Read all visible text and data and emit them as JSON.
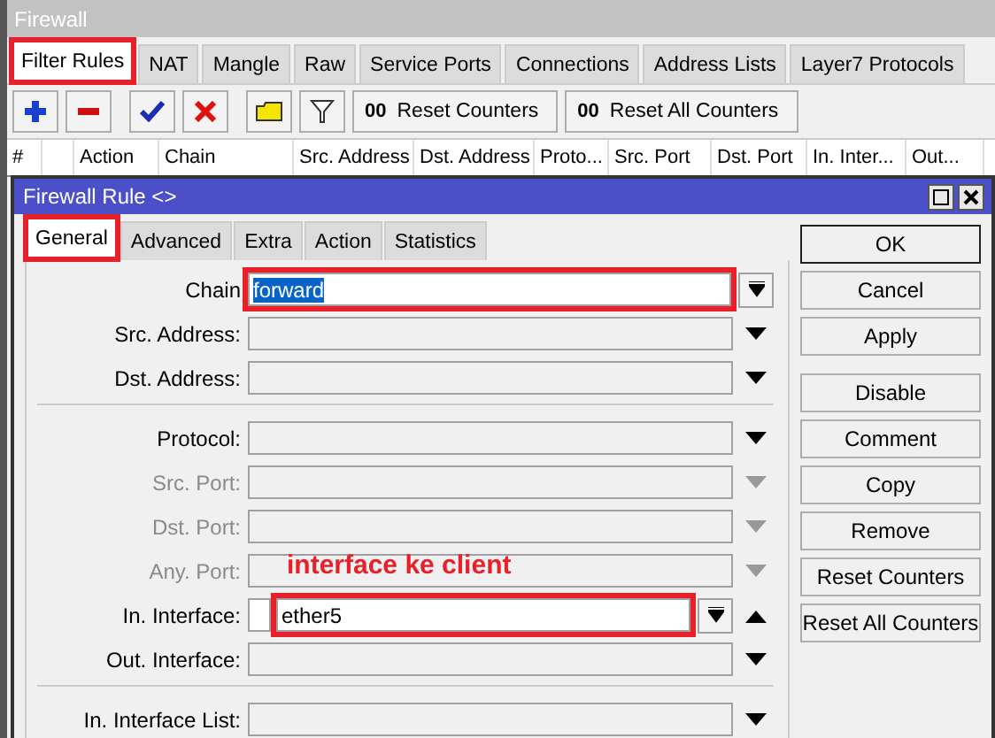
{
  "window": {
    "title": "Firewall"
  },
  "tabs": [
    {
      "label": "Filter Rules",
      "selected": true,
      "highlighted": true
    },
    {
      "label": "NAT",
      "selected": false,
      "highlighted": false
    },
    {
      "label": "Mangle",
      "selected": false,
      "highlighted": false
    },
    {
      "label": "Raw",
      "selected": false,
      "highlighted": false
    },
    {
      "label": "Service Ports",
      "selected": false,
      "highlighted": false
    },
    {
      "label": "Connections",
      "selected": false,
      "highlighted": false
    },
    {
      "label": "Address Lists",
      "selected": false,
      "highlighted": false
    },
    {
      "label": "Layer7 Protocols",
      "selected": false,
      "highlighted": false
    }
  ],
  "toolbar": {
    "icons": [
      {
        "kind": "add"
      },
      {
        "kind": "remove"
      },
      {
        "kind": "enable"
      },
      {
        "kind": "disable"
      },
      {
        "kind": "comment"
      },
      {
        "kind": "filter"
      }
    ],
    "buttons": [
      {
        "prefix": "00",
        "label": "Reset Counters"
      },
      {
        "prefix": "00",
        "label": "Reset All Counters"
      }
    ]
  },
  "table": {
    "columns": [
      {
        "label": "#"
      },
      {},
      {
        "label": "Action"
      },
      {
        "label": "Chain"
      },
      {
        "label": "Src. Address"
      },
      {
        "label": "Dst. Address"
      },
      {
        "label": "Proto..."
      },
      {
        "label": "Src. Port"
      },
      {
        "label": "Dst. Port"
      },
      {
        "label": "In. Inter..."
      },
      {
        "label": "Out..."
      }
    ]
  },
  "dialog": {
    "title": "Firewall Rule <>",
    "tabs": [
      {
        "label": "General",
        "selected": true,
        "highlighted": true
      },
      {
        "label": "Advanced",
        "selected": false,
        "highlighted": false
      },
      {
        "label": "Extra",
        "selected": false,
        "highlighted": false
      },
      {
        "label": "Action",
        "selected": false,
        "highlighted": false
      },
      {
        "label": "Statistics",
        "selected": false,
        "highlighted": false
      }
    ],
    "fields": [
      {
        "kind": "select",
        "label": "Chain",
        "value": "forward",
        "selected": true,
        "highlighted": true,
        "disabled": false
      },
      {
        "kind": "arrow",
        "label": "Src. Address:",
        "disabled": false
      },
      {
        "kind": "arrow",
        "label": "Dst. Address:",
        "disabled": false
      },
      {
        "kind": "separator"
      },
      {
        "kind": "arrow",
        "label": "Protocol:",
        "disabled": false
      },
      {
        "kind": "arrow",
        "label": "Src. Port:",
        "disabled": true
      },
      {
        "kind": "arrow",
        "label": "Dst. Port:",
        "disabled": true
      },
      {
        "kind": "arrow",
        "label": "Any. Port:",
        "disabled": true,
        "annotation": "interface ke client"
      },
      {
        "kind": "interface",
        "label": "In. Interface:",
        "value": "ether5",
        "selected": false,
        "highlighted": true,
        "disabled": false,
        "negated": false
      },
      {
        "kind": "arrow",
        "label": "Out. Interface:",
        "disabled": false
      },
      {
        "kind": "separator"
      },
      {
        "kind": "arrow",
        "label": "In. Interface List:",
        "disabled": false
      }
    ],
    "buttons": [
      {
        "label": "OK",
        "default": true
      },
      {
        "label": "Cancel",
        "default": false
      },
      {
        "label": "Apply",
        "default": false
      },
      {
        "label": "Disable",
        "default": false
      },
      {
        "label": "Comment",
        "default": false
      },
      {
        "label": "Copy",
        "default": false
      },
      {
        "label": "Remove",
        "default": false
      },
      {
        "label": "Reset Counters",
        "default": false
      },
      {
        "label": "Reset All Counters",
        "default": false
      }
    ]
  }
}
